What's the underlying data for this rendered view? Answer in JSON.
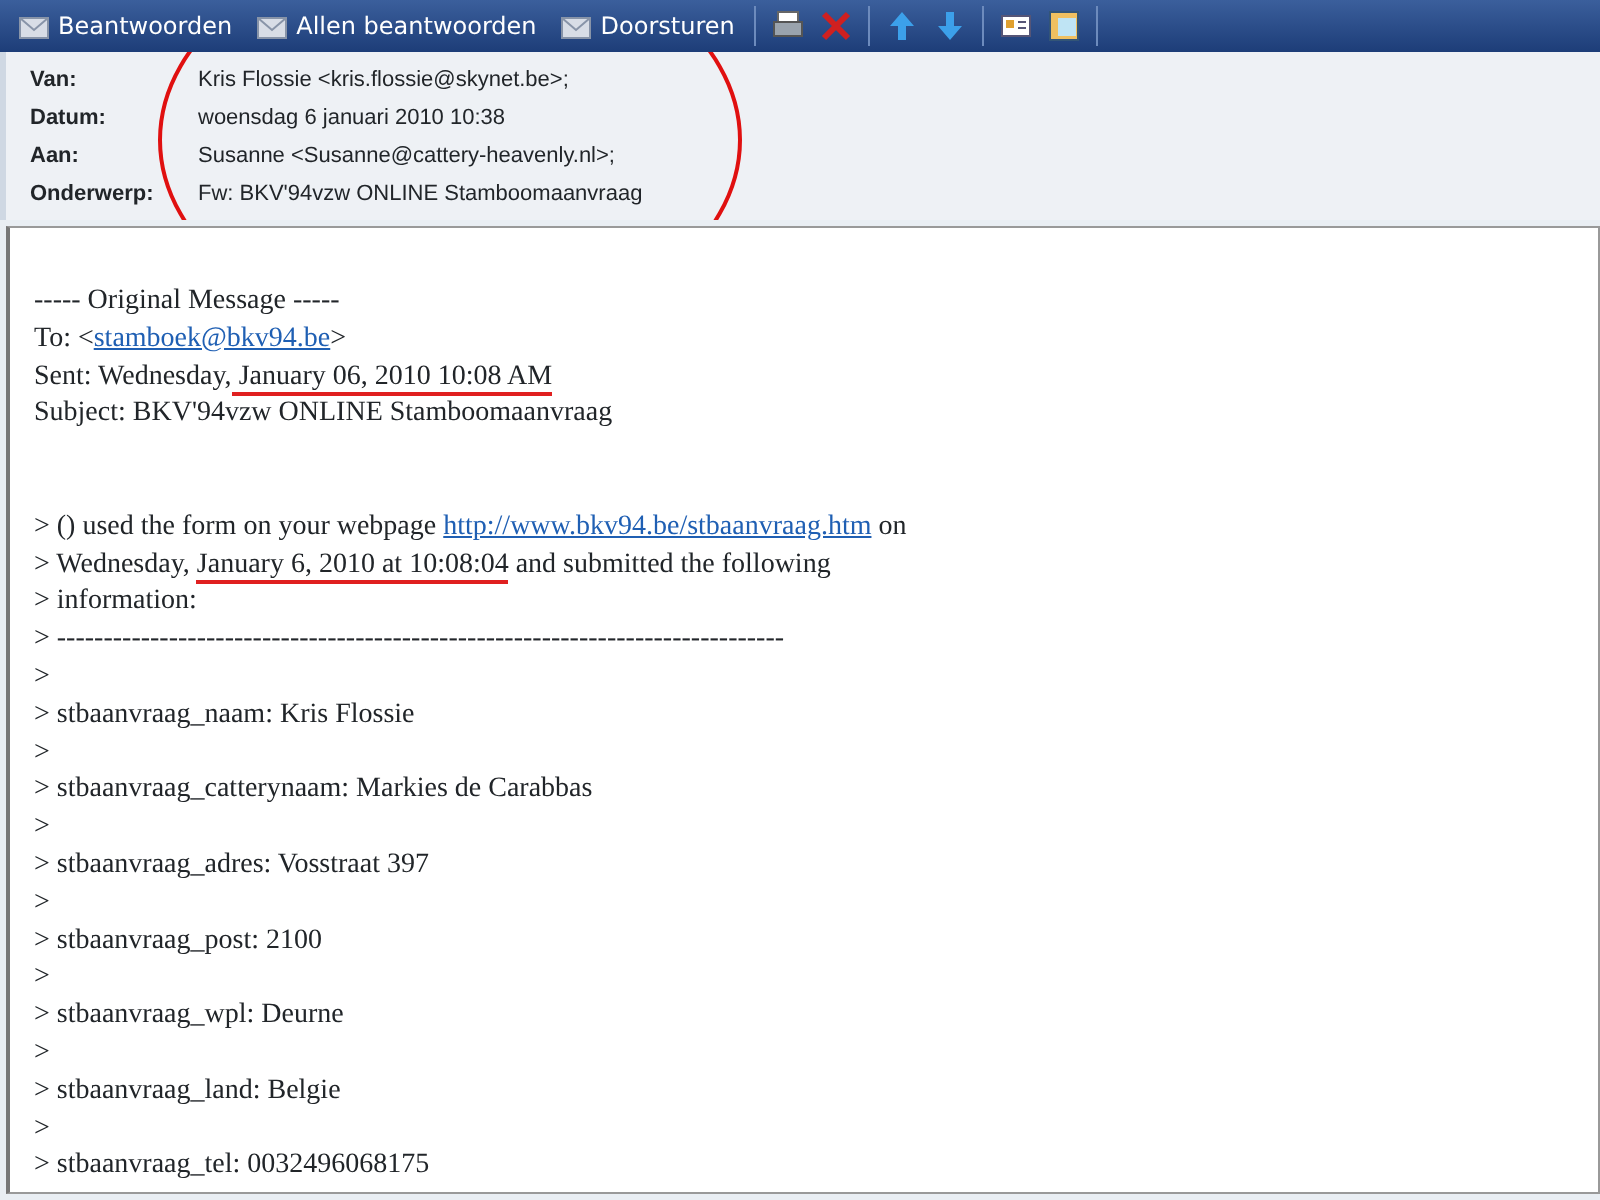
{
  "toolbar": {
    "buttons": [
      {
        "label": "Beantwoorden"
      },
      {
        "label": "Allen beantwoorden"
      },
      {
        "label": "Doorsturen"
      }
    ]
  },
  "header": {
    "fields": [
      {
        "label": "Van:",
        "value": "Kris Flossie <kris.flossie@skynet.be>;"
      },
      {
        "label": "Datum:",
        "value": "woensdag 6 januari 2010 10:38"
      },
      {
        "label": "Aan:",
        "value": "Susanne <Susanne@cattery-heavenly.nl>;"
      },
      {
        "label": "Onderwerp:",
        "value": "Fw: BKV'94vzw ONLINE Stamboomaanvraag"
      }
    ]
  },
  "body": {
    "lines": [
      {
        "kind": "text",
        "parts": [
          {
            "kind": "plain",
            "text": "----- Original Message -----"
          }
        ]
      },
      {
        "kind": "text",
        "parts": [
          {
            "kind": "plain",
            "text": "To: <"
          },
          {
            "kind": "link",
            "text": "stamboek@bkv94.be"
          },
          {
            "kind": "plain",
            "text": ">"
          }
        ]
      },
      {
        "kind": "text",
        "parts": [
          {
            "kind": "plain",
            "text": "Sent: Wednesday,"
          },
          {
            "kind": "marked",
            "text": " January 06, 2010 10:08 AM"
          }
        ]
      },
      {
        "kind": "text",
        "parts": [
          {
            "kind": "plain",
            "text": "Subject: BKV'94vzw ONLINE Stamboomaanvraag"
          }
        ]
      },
      {
        "kind": "blank"
      },
      {
        "kind": "blank"
      },
      {
        "kind": "text",
        "parts": [
          {
            "kind": "plain",
            "text": "> () used the form on your webpage "
          },
          {
            "kind": "link",
            "text": "http://www.bkv94.be/stbaanvraag.htm"
          },
          {
            "kind": "plain",
            "text": " on"
          }
        ]
      },
      {
        "kind": "text",
        "parts": [
          {
            "kind": "plain",
            "text": "> Wednesday, "
          },
          {
            "kind": "marked",
            "text": "January 6, 2010 at 10:08:04"
          },
          {
            "kind": "plain",
            "text": " and submitted the following"
          }
        ]
      },
      {
        "kind": "text",
        "parts": [
          {
            "kind": "plain",
            "text": "> information:"
          }
        ]
      },
      {
        "kind": "text",
        "parts": [
          {
            "kind": "plain",
            "text": "> ------------------------------------------------------------------------------"
          }
        ]
      },
      {
        "kind": "text",
        "parts": [
          {
            "kind": "plain",
            "text": ">"
          }
        ]
      },
      {
        "kind": "text",
        "parts": [
          {
            "kind": "plain",
            "text": "> stbaanvraag_naam: Kris Flossie"
          }
        ]
      },
      {
        "kind": "text",
        "parts": [
          {
            "kind": "plain",
            "text": ">"
          }
        ]
      },
      {
        "kind": "text",
        "parts": [
          {
            "kind": "plain",
            "text": "> stbaanvraag_catterynaam: Markies de Carabbas"
          }
        ]
      },
      {
        "kind": "text",
        "parts": [
          {
            "kind": "plain",
            "text": ">"
          }
        ]
      },
      {
        "kind": "text",
        "parts": [
          {
            "kind": "plain",
            "text": "> stbaanvraag_adres: Vosstraat 397"
          }
        ]
      },
      {
        "kind": "text",
        "parts": [
          {
            "kind": "plain",
            "text": ">"
          }
        ]
      },
      {
        "kind": "text",
        "parts": [
          {
            "kind": "plain",
            "text": "> stbaanvraag_post: 2100"
          }
        ]
      },
      {
        "kind": "text",
        "parts": [
          {
            "kind": "plain",
            "text": ">"
          }
        ]
      },
      {
        "kind": "text",
        "parts": [
          {
            "kind": "plain",
            "text": "> stbaanvraag_wpl: Deurne"
          }
        ]
      },
      {
        "kind": "text",
        "parts": [
          {
            "kind": "plain",
            "text": ">"
          }
        ]
      },
      {
        "kind": "text",
        "parts": [
          {
            "kind": "plain",
            "text": "> stbaanvraag_land: Belgie"
          }
        ]
      },
      {
        "kind": "text",
        "parts": [
          {
            "kind": "plain",
            "text": ">"
          }
        ]
      },
      {
        "kind": "text",
        "parts": [
          {
            "kind": "plain",
            "text": "> stbaanvraag_tel: 0032496068175"
          }
        ]
      }
    ]
  }
}
